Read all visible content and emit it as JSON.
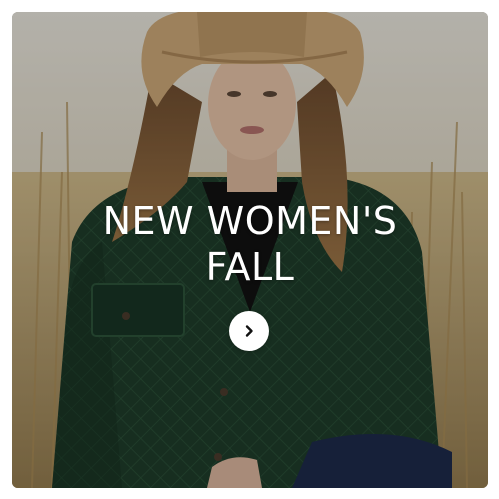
{
  "promo": {
    "title_line1": "NEW WOMEN'S",
    "title_line2": "FALL",
    "cta_icon": "chevron-right-icon"
  },
  "colors": {
    "jacket": "#1f3d2c",
    "hat": "#c9a677",
    "text": "#ffffff"
  }
}
